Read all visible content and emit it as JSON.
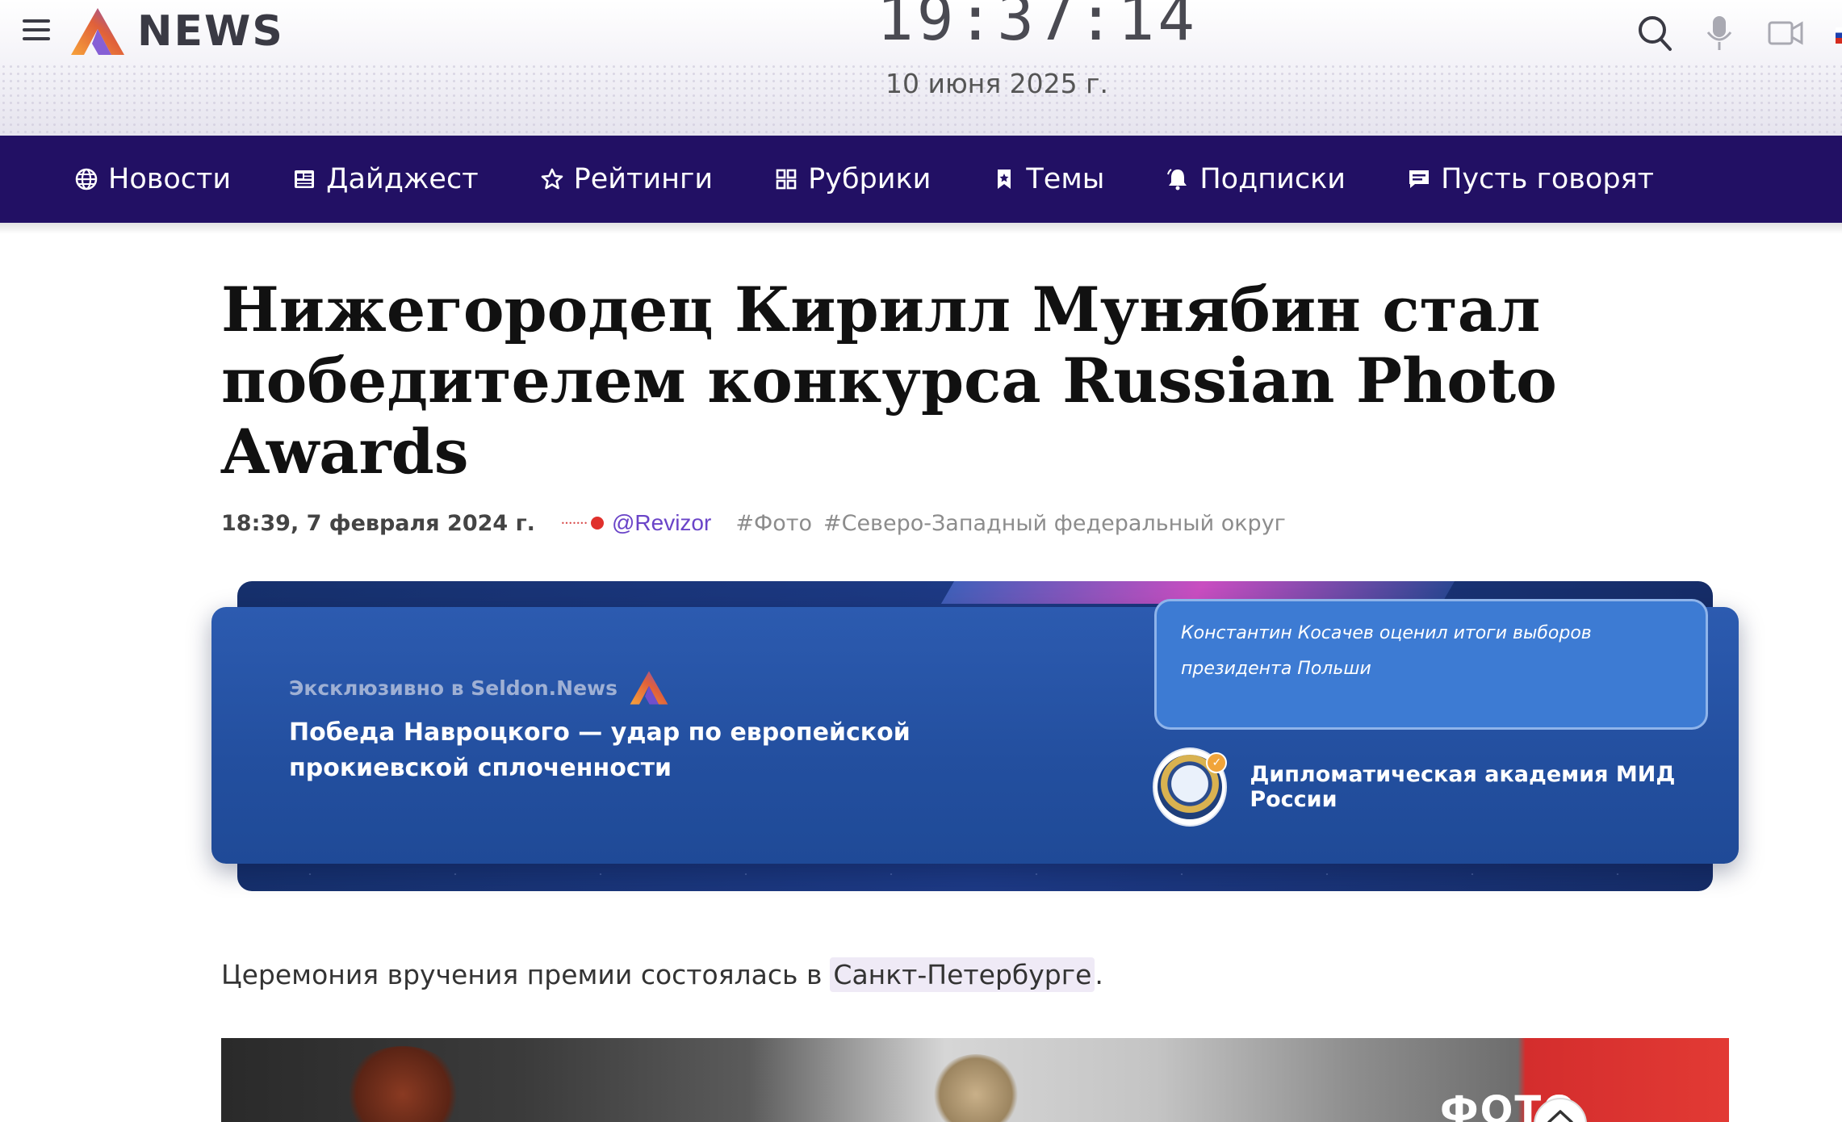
{
  "header": {
    "logo_text": "NEWS",
    "clock": "19:37:14",
    "date": "10 июня 2025 г."
  },
  "nav": {
    "items": [
      {
        "label": "Новости",
        "icon": "globe-icon"
      },
      {
        "label": "Дайджест",
        "icon": "digest-icon"
      },
      {
        "label": "Рейтинги",
        "icon": "star-icon"
      },
      {
        "label": "Рубрики",
        "icon": "grid-icon"
      },
      {
        "label": "Темы",
        "icon": "bookmark-icon"
      },
      {
        "label": "Подписки",
        "icon": "bell-icon"
      },
      {
        "label": "Пусть говорят",
        "icon": "chat-icon"
      }
    ]
  },
  "article": {
    "title": "Нижегородец Кирилл Мунябин стал победителем конкурса Russian Photo Awards",
    "published": "18:39, 7 февраля 2024 г.",
    "source_handle": "@Revizor",
    "tags": [
      "#Фото",
      "#Северо-Западный федеральный округ"
    ],
    "lead_text": "Церемония вручения премии состоялась в",
    "lead_link": "Санкт-Петербурге",
    "lead_end": "."
  },
  "promo": {
    "exclusive_label": "Эксклюзивно в Seldon.News",
    "headline": "Победа Навроцкого — удар по европейской прокиевской сплоченности",
    "quote": "Константин Косачев оценил итоги выборов президента Польши",
    "author": "Дипломатическая академия МИД России"
  },
  "photo": {
    "sign_text": "ФОТО"
  },
  "colors": {
    "nav_bg": "#221064",
    "promo_bg": "#234f9f",
    "quote_bg": "#3d7bd3",
    "handle": "#6a44c8",
    "logo_orange": "#f28a2e",
    "logo_purple": "#7a4fd0"
  }
}
